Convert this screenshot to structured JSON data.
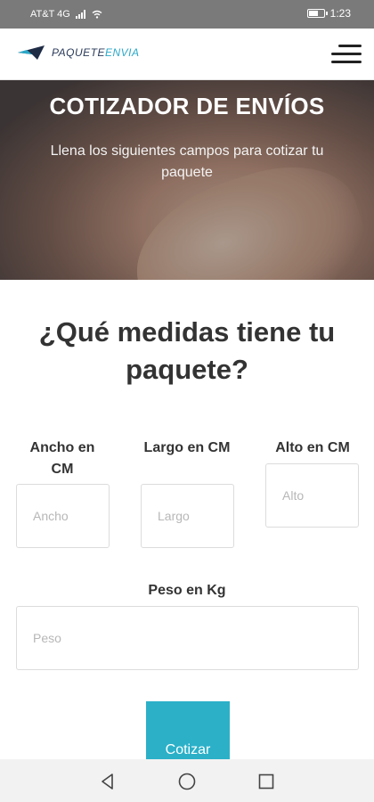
{
  "status_bar": {
    "carrier": "AT&T 4G",
    "time": "1:23"
  },
  "header": {
    "logo_main": "PAQUETE",
    "logo_accent": "ENVIA"
  },
  "hero": {
    "title": "COTIZADOR DE ENVÍOS",
    "subtitle": "Llena los siguientes campos para cotizar tu paquete"
  },
  "form": {
    "question": "¿Qué medidas tiene tu paquete?",
    "ancho": {
      "label": "Ancho en CM",
      "placeholder": "Ancho",
      "value": ""
    },
    "largo": {
      "label": "Largo en CM",
      "placeholder": "Largo",
      "value": ""
    },
    "alto": {
      "label": "Alto en CM",
      "placeholder": "Alto",
      "value": ""
    },
    "peso": {
      "label": "Peso en Kg",
      "placeholder": "Peso",
      "value": ""
    },
    "submit_label": "Cotizar"
  },
  "colors": {
    "accent": "#2bb0c8",
    "status_bar": "#7a7a7a"
  },
  "icons": [
    "wifi-icon",
    "signal-icon",
    "battery-icon",
    "paper-plane-logo-icon",
    "hamburger-menu-icon",
    "back-icon",
    "home-icon",
    "recents-icon"
  ]
}
